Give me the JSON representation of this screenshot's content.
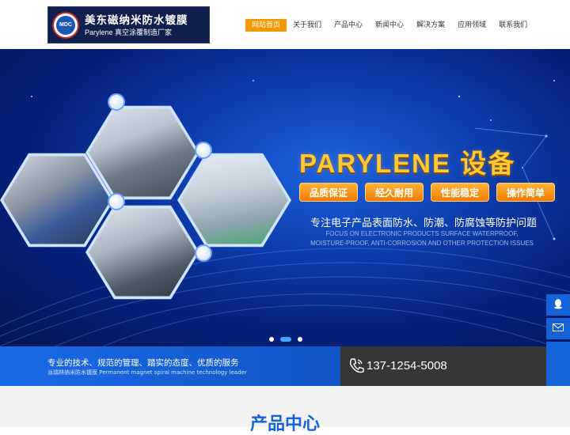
{
  "header": {
    "logo_badge": "MDC",
    "logo_title": "美东磁纳米防水镀膜",
    "logo_subtitle": "Parylene 真空涂覆制造厂家"
  },
  "nav": {
    "items": [
      {
        "label": "网站首页",
        "active": true
      },
      {
        "label": "关于我们",
        "active": false
      },
      {
        "label": "产品中心",
        "active": false
      },
      {
        "label": "新闻中心",
        "active": false
      },
      {
        "label": "解决方案",
        "active": false
      },
      {
        "label": "应用领域",
        "active": false
      },
      {
        "label": "联系我们",
        "active": false
      }
    ]
  },
  "banner": {
    "headline": "PARYLENE 设备",
    "tags": [
      "品质保证",
      "经久耐用",
      "性能稳定",
      "操作简单"
    ],
    "subtitle_cn": "专注电子产品表面防水、防潮、防腐蚀等防护问题",
    "subtitle_en": "FOCUS ON ELECTRONIC PRODUCTS SURFACE WATERPROOF, MOISTURE-PROOF, ANTI-CORROSION AND OTHER PROTECTION ISSUES",
    "slides": 3,
    "active_slide": 2
  },
  "strip": {
    "slogan": "专业的技术、规范的管理、踏实的态度、优质的服务",
    "slogan_sub": "派瑞林纳米防水镀膜 Permanent magnet spiral machine technology leader",
    "phone": "137-1254-5008"
  },
  "side_float": [
    "qq-icon",
    "mail-icon",
    "phone-icon",
    "back-to-top-icon"
  ],
  "section": {
    "title": "产品中心"
  },
  "colors": {
    "accent": "#f39800",
    "brand_blue": "#1463d9",
    "dark": "#363636"
  }
}
